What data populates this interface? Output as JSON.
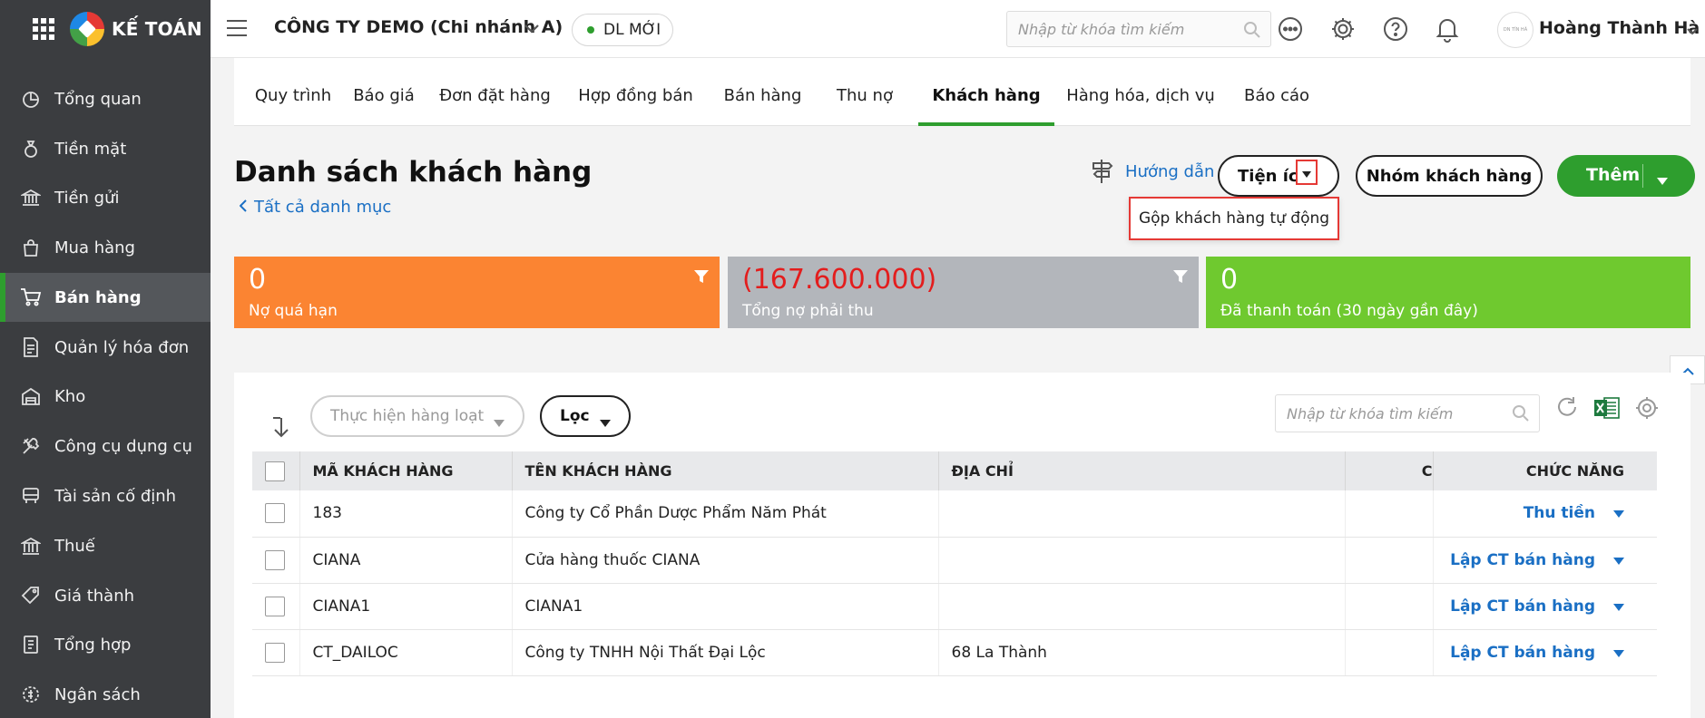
{
  "sidebar": {
    "brand": "KẾ TOÁN",
    "items": [
      {
        "label": "Tổng quan",
        "icon": "dashboard-icon"
      },
      {
        "label": "Tiền mặt",
        "icon": "money-bag-icon"
      },
      {
        "label": "Tiền gửi",
        "icon": "bank-deposit-icon"
      },
      {
        "label": "Mua hàng",
        "icon": "shopping-bag-icon"
      },
      {
        "label": "Bán hàng",
        "icon": "cart-icon",
        "active": true
      },
      {
        "label": "Quản lý hóa đơn",
        "icon": "invoice-icon"
      },
      {
        "label": "Kho",
        "icon": "warehouse-icon"
      },
      {
        "label": "Công cụ dụng cụ",
        "icon": "tools-icon"
      },
      {
        "label": "Tài sản cố định",
        "icon": "fixed-asset-icon"
      },
      {
        "label": "Thuế",
        "icon": "tax-icon"
      },
      {
        "label": "Giá thành",
        "icon": "price-tag-icon"
      },
      {
        "label": "Tổng hợp",
        "icon": "summary-icon"
      },
      {
        "label": "Ngân sách",
        "icon": "budget-icon"
      }
    ]
  },
  "topbar": {
    "company": "CÔNG TY DEMO (Chi nhánh A)",
    "data_badge": "DL MỚI",
    "search_placeholder": "Nhập từ khóa tìm kiếm",
    "username": "Hoàng Thành Hà",
    "avatar_text": "DN TÍN HÃ"
  },
  "tabs": [
    {
      "label": "Quy trình"
    },
    {
      "label": "Báo giá"
    },
    {
      "label": "Đơn đặt hàng"
    },
    {
      "label": "Hợp đồng bán"
    },
    {
      "label": "Bán hàng"
    },
    {
      "label": "Thu nợ"
    },
    {
      "label": "Khách hàng",
      "active": true
    },
    {
      "label": "Hàng hóa, dịch vụ"
    },
    {
      "label": "Báo cáo"
    }
  ],
  "page": {
    "title": "Danh sách khách hàng",
    "breadcrumb": "Tất cả danh mục",
    "guide": "Hướng dẫn",
    "utilities_button": "Tiện ích",
    "groups_button": "Nhóm khách hàng",
    "add_button": "Thêm",
    "dropdown_item": "Gộp khách hàng tự động"
  },
  "cards": [
    {
      "value": "0",
      "caption": "Nợ quá hạn",
      "color": "#fb8432"
    },
    {
      "value": "(167.600.000)",
      "caption": "Tổng nợ phải thu",
      "color": "#b3b6bb",
      "value_color": "#e31d1d"
    },
    {
      "value": "0",
      "caption": "Đã thanh toán (30 ngày gần đây)",
      "color": "#6fc92f"
    }
  ],
  "list": {
    "bulk_action": "Thực hiện hàng loạt",
    "filter": "Lọc",
    "search_placeholder": "Nhập từ khóa tìm kiếm",
    "columns": {
      "code": "MÃ KHÁCH HÀNG",
      "name": "TÊN KHÁCH HÀNG",
      "address": "ĐỊA CHỈ",
      "extra": "C",
      "function": "CHỨC NĂNG"
    },
    "rows": [
      {
        "code": "183",
        "name": "Công ty Cổ Phần Dược Phẩm Năm Phát",
        "address": "",
        "action": "Thu tiền"
      },
      {
        "code": "CIANA",
        "name": "Cửa hàng thuốc CIANA",
        "address": "",
        "action": "Lập CT bán hàng"
      },
      {
        "code": "CIANA1",
        "name": "CIANA1",
        "address": "",
        "action": "Lập CT bán hàng"
      },
      {
        "code": "CT_DAILOC",
        "name": "Công ty TNHH Nội Thất Đại Lộc",
        "address": "68 La Thành",
        "action": "Lập CT bán hàng"
      }
    ]
  },
  "colors": {
    "accent": "#2e9e2e",
    "link": "#1a6fc4",
    "highlight": "#e53935"
  }
}
